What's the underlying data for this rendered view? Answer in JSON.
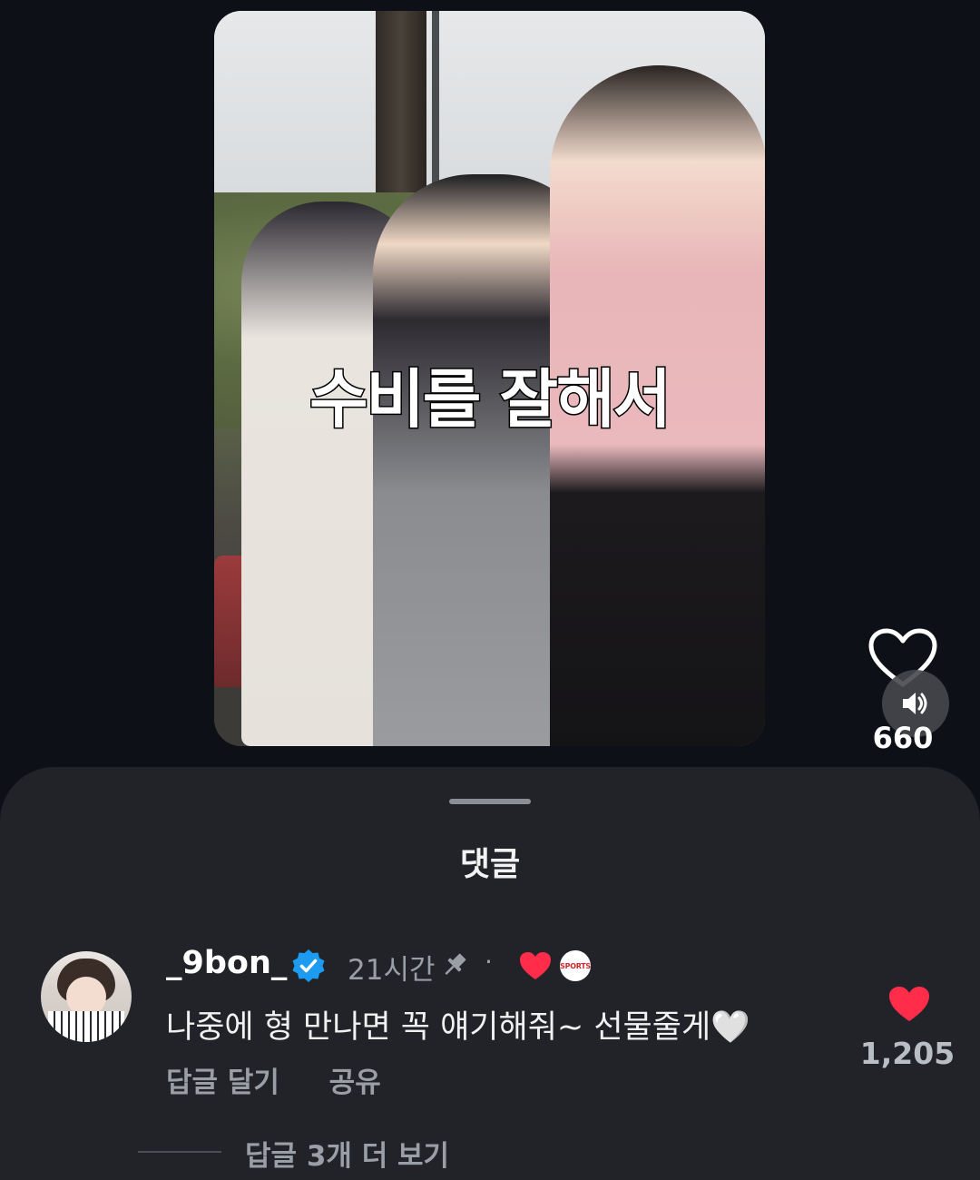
{
  "video": {
    "caption": "수비를 잘해서",
    "like_count": "660"
  },
  "sheet": {
    "title": "댓글"
  },
  "comment": {
    "username": "_9bon_",
    "time": "21시간",
    "separator": "·",
    "text": "나중에 형 만나면 꼭 얘기해줘~ 선물줄게🤍",
    "reply_label": "답글 달기",
    "share_label": "공유",
    "like_count": "1,205",
    "badge_text": "SPORTS"
  },
  "replies": {
    "more_label": "답글 3개 더 보기"
  },
  "colors": {
    "accent_red": "#ff2d4a",
    "verified_blue": "#1d9bf0",
    "sheet_bg": "#212328",
    "page_bg": "#0d1117"
  }
}
